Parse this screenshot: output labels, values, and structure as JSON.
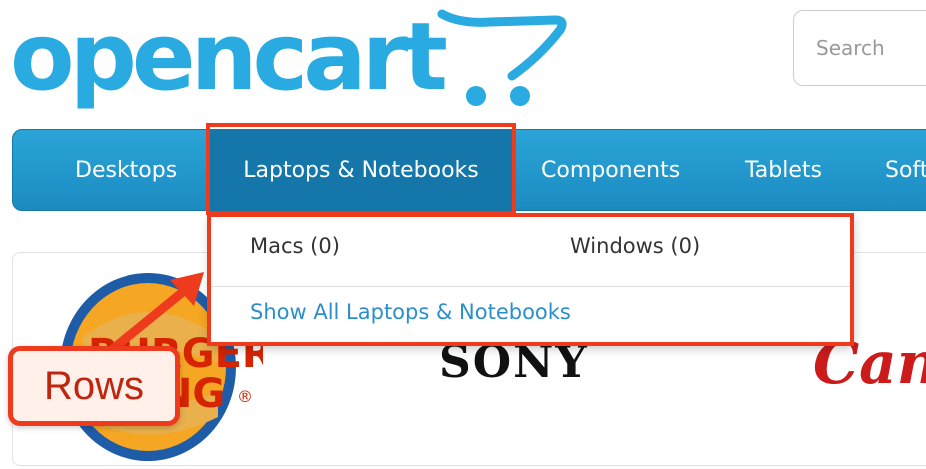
{
  "logo": {
    "text": "opencart",
    "icon": "shopping-cart-icon",
    "color": "#29abe2"
  },
  "search": {
    "placeholder": "Search"
  },
  "menu": {
    "items": [
      {
        "label": "Desktops"
      },
      {
        "label": "Laptops & Notebooks",
        "active": true
      },
      {
        "label": "Components"
      },
      {
        "label": "Tablets"
      },
      {
        "label": "Soft"
      }
    ],
    "color": "#1b8cc2"
  },
  "dropdown": {
    "items": [
      {
        "label": "Macs (0)"
      },
      {
        "label": "Windows (0)"
      }
    ],
    "show_all": "Show All Laptops & Notebooks"
  },
  "brands": {
    "burger_king": "BURGER KING",
    "sony": "SONY",
    "canon": "Can"
  },
  "annotation": {
    "label": "Rows",
    "color": "#ee3b1e"
  }
}
